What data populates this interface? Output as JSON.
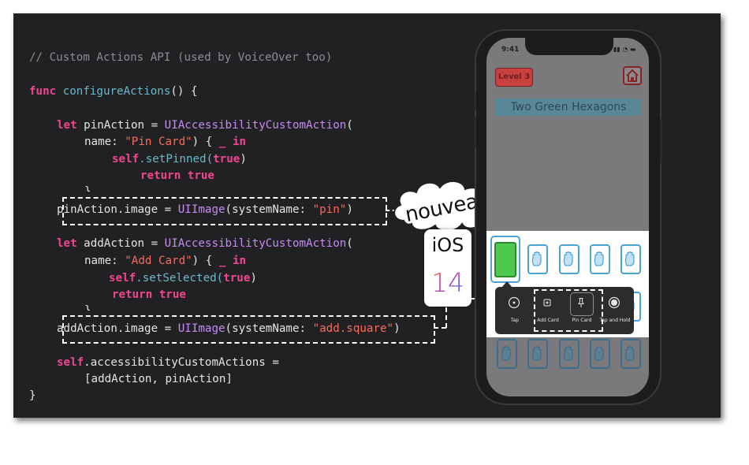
{
  "code": {
    "comment": "// Custom Actions API (used by VoiceOver too)",
    "func_kw": "func",
    "func_name": "configureActions",
    "func_tail": "() {",
    "pin_let": "let",
    "pin_var": " pinAction = ",
    "pin_type": "UIAccessibilityCustomAction",
    "pin_paren": "(",
    "pin_name_label": "name: ",
    "pin_name_value": "\"Pin Card\"",
    "pin_closure": ") { ",
    "underscore": "_",
    "in_kw": "in",
    "self_kw": "self",
    "pin_call": ".setPinned(",
    "true_kw": "true",
    "close_paren": ")",
    "return_kw": "return",
    "close_brace": "}",
    "pin_image_a": "pinAction.image = ",
    "uiimage": "UIImage",
    "sysname": "(systemName: ",
    "pin_image_str": "\"pin\"",
    "add_var": " addAction = ",
    "add_name_value": "\"Add Card\"",
    "add_call": ".setSelected(",
    "add_image_a": "addAction.image = ",
    "add_image_str": "\"add.square\"",
    "custom_actions": ".accessibilityCustomActions =",
    "actions_list": "[addAction, pinAction]"
  },
  "callout": {
    "cloud_text": "nouveau",
    "badge_label": "iOS",
    "badge_number": "14"
  },
  "phone": {
    "time": "9:41",
    "status": "▮▮ ◔ ▬",
    "level": "Level 3",
    "banner": "Two Green Hexagons",
    "menu": {
      "tap": "Tap",
      "add_card": "Add Card",
      "pin_card": "Pin Card",
      "tap_hold": "Tap and Hold"
    }
  }
}
